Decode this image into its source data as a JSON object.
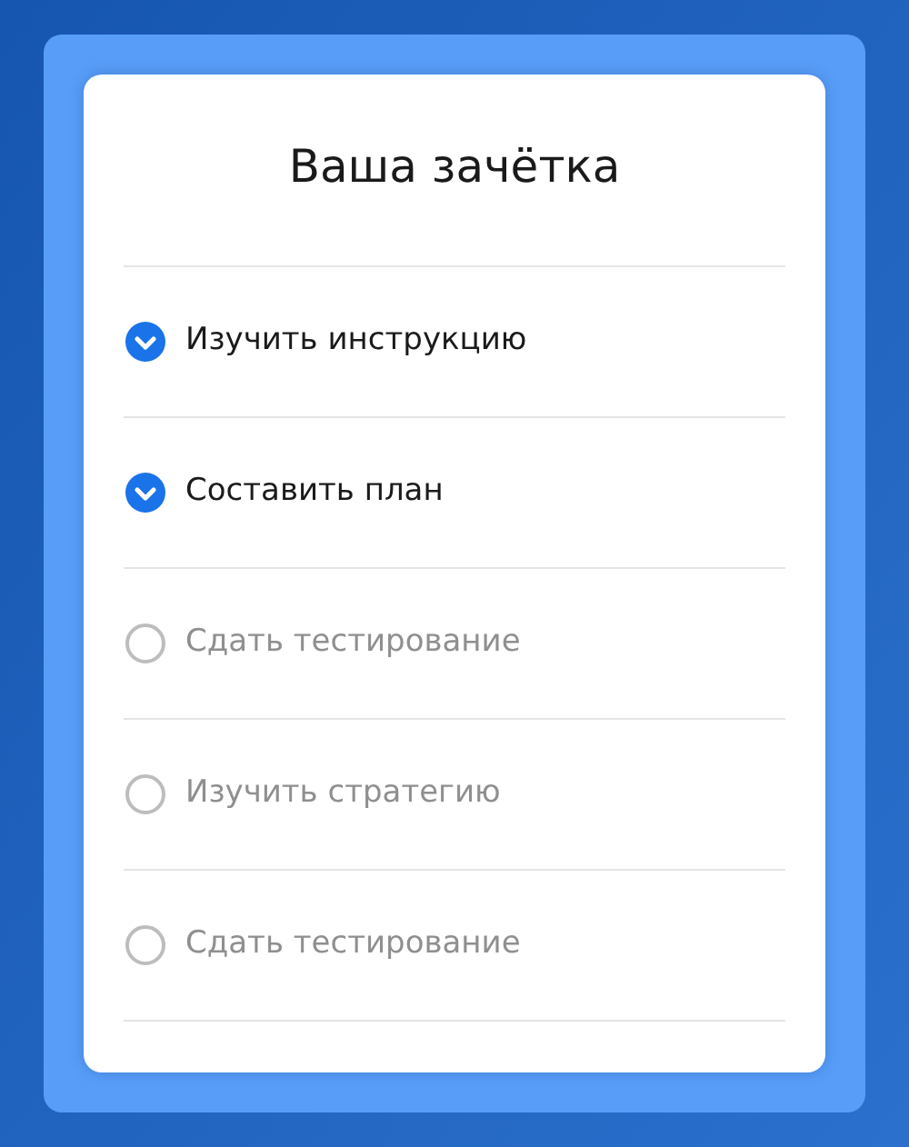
{
  "title": "Ваша зачётка",
  "tasks": [
    {
      "label": "Изучить инструкцию",
      "checked": true
    },
    {
      "label": "Составить план",
      "checked": true
    },
    {
      "label": "Сдать тестирование",
      "checked": false
    },
    {
      "label": "Изучить стратегию",
      "checked": false
    },
    {
      "label": "Сдать тестирование",
      "checked": false
    }
  ]
}
